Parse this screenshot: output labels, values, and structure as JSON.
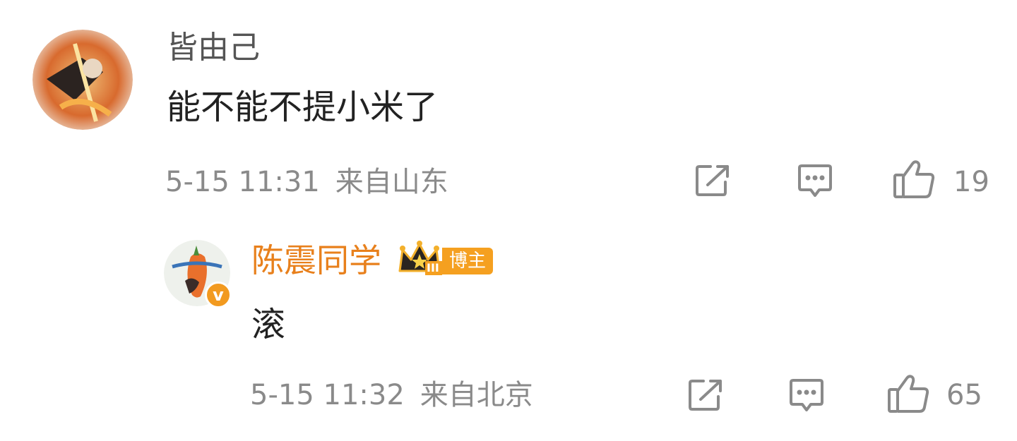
{
  "comment": {
    "username": "皆由己",
    "text": "能不能不提小米了",
    "time": "5-15 11:31",
    "location": "来自山东",
    "like_count": "19",
    "icons": {
      "share": "share-icon",
      "reply": "comment-icon",
      "like": "thumbs-up-icon"
    }
  },
  "reply": {
    "username": "陈震同学",
    "badge_label": "博主",
    "crown_level": "III",
    "verified_mark": "v",
    "text": "滚",
    "time": "5-15 11:32",
    "location": "来自北京",
    "like_count": "65",
    "icons": {
      "share": "share-icon",
      "reply": "comment-icon",
      "like": "thumbs-up-icon"
    }
  },
  "colors": {
    "username_gray": "#555555",
    "blogger_orange": "#e8801c",
    "badge_orange": "#f5a020",
    "meta_gray": "#8a8a8a",
    "text_dark": "#222222"
  }
}
